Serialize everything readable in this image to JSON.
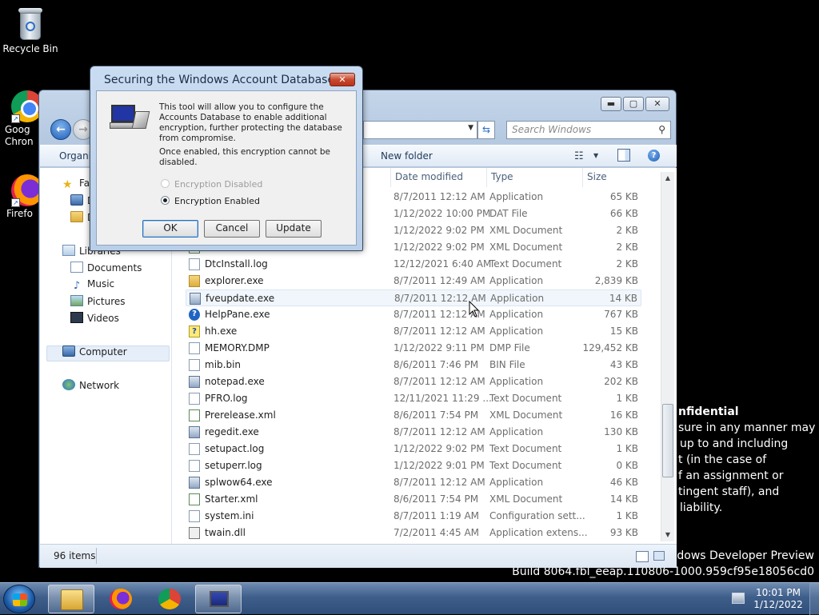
{
  "desktop": {
    "icons": [
      {
        "label": "Recycle Bin"
      },
      {
        "label": "Goog\nChron"
      },
      {
        "label": "Firefo"
      }
    ],
    "confidential": {
      "heading": "nfidential",
      "lines": [
        "sure in any manner may",
        "up to and including",
        "t (in the case of",
        "f an assignment or",
        "tingent staff), and",
        "liability."
      ]
    },
    "watermark": {
      "line1": "ndows Developer Preview",
      "line2": "Build 8064.fbl_eeap.110806-1000.959cf95e18056cd0"
    }
  },
  "explorer": {
    "window_controls": {
      "minimize": "▬",
      "maximize": "▢",
      "close": "✕"
    },
    "search_placeholder": "Search Windows",
    "command_bar": {
      "organize": "Organiz",
      "new_folder": "New folder"
    },
    "nav": {
      "favorites": "Fav",
      "fav_item1": "D",
      "fav_item2": "D",
      "libraries": "Libraries",
      "documents": "Documents",
      "music": "Music",
      "pictures": "Pictures",
      "videos": "Videos",
      "computer": "Computer",
      "network": "Network"
    },
    "columns": {
      "date": "Date modified",
      "type": "Type",
      "size": "Size"
    },
    "files": [
      {
        "name": "",
        "date": "8/7/2011 12:12 AM",
        "type": "Application",
        "size": "65 KB",
        "icon": "app"
      },
      {
        "name": "",
        "date": "1/12/2022 10:00 PM",
        "type": "DAT File",
        "size": "66 KB",
        "icon": "txt"
      },
      {
        "name": "",
        "date": "1/12/2022 9:02 PM",
        "type": "XML Document",
        "size": "2 KB",
        "icon": "xml"
      },
      {
        "name": "",
        "date": "1/12/2022 9:02 PM",
        "type": "XML Document",
        "size": "2 KB",
        "icon": "xml"
      },
      {
        "name": "DtcInstall.log",
        "date": "12/12/2021 6:40 AM",
        "type": "Text Document",
        "size": "2 KB",
        "icon": "txt"
      },
      {
        "name": "explorer.exe",
        "date": "8/7/2011 12:49 AM",
        "type": "Application",
        "size": "2,839 KB",
        "icon": "folderic"
      },
      {
        "name": "fveupdate.exe",
        "date": "8/7/2011 12:12 AM",
        "type": "Application",
        "size": "14 KB",
        "icon": "app"
      },
      {
        "name": "HelpPane.exe",
        "date": "8/7/2011 12:12 AM",
        "type": "Application",
        "size": "767 KB",
        "icon": "help"
      },
      {
        "name": "hh.exe",
        "date": "8/7/2011 12:12 AM",
        "type": "Application",
        "size": "15 KB",
        "icon": "yel"
      },
      {
        "name": "MEMORY.DMP",
        "date": "1/12/2022 9:11 PM",
        "type": "DMP File",
        "size": "129,452 KB",
        "icon": "txt"
      },
      {
        "name": "mib.bin",
        "date": "8/6/2011 7:46 PM",
        "type": "BIN File",
        "size": "43 KB",
        "icon": "txt"
      },
      {
        "name": "notepad.exe",
        "date": "8/7/2011 12:12 AM",
        "type": "Application",
        "size": "202 KB",
        "icon": "app"
      },
      {
        "name": "PFRO.log",
        "date": "12/11/2021 11:29 ...",
        "type": "Text Document",
        "size": "1 KB",
        "icon": "txt"
      },
      {
        "name": "Prerelease.xml",
        "date": "8/6/2011 7:54 PM",
        "type": "XML Document",
        "size": "16 KB",
        "icon": "xml"
      },
      {
        "name": "regedit.exe",
        "date": "8/7/2011 12:12 AM",
        "type": "Application",
        "size": "130 KB",
        "icon": "app"
      },
      {
        "name": "setupact.log",
        "date": "1/12/2022 9:02 PM",
        "type": "Text Document",
        "size": "1 KB",
        "icon": "txt"
      },
      {
        "name": "setuperr.log",
        "date": "1/12/2022 9:01 PM",
        "type": "Text Document",
        "size": "0 KB",
        "icon": "txt"
      },
      {
        "name": "splwow64.exe",
        "date": "8/7/2011 12:12 AM",
        "type": "Application",
        "size": "46 KB",
        "icon": "app"
      },
      {
        "name": "Starter.xml",
        "date": "8/6/2011 7:54 PM",
        "type": "XML Document",
        "size": "14 KB",
        "icon": "xml"
      },
      {
        "name": "system.ini",
        "date": "8/7/2011 1:19 AM",
        "type": "Configuration sett...",
        "size": "1 KB",
        "icon": "txt"
      },
      {
        "name": "twain.dll",
        "date": "7/2/2011 4:45 AM",
        "type": "Application extens...",
        "size": "93 KB",
        "icon": "dll"
      }
    ],
    "status": {
      "count": "96 items"
    }
  },
  "dialog": {
    "title": "Securing the Windows Account Database",
    "close": "✕",
    "text1": "This tool will allow you to configure the Accounts Database to enable additional encryption, further protecting the database from compromise.",
    "text2": "Once enabled, this encryption cannot be disabled.",
    "radio_disabled": "Encryption Disabled",
    "radio_enabled": "Encryption Enabled",
    "ok": "OK",
    "cancel": "Cancel",
    "update": "Update"
  },
  "taskbar": {
    "time": "10:01 PM",
    "date": "1/12/2022"
  }
}
